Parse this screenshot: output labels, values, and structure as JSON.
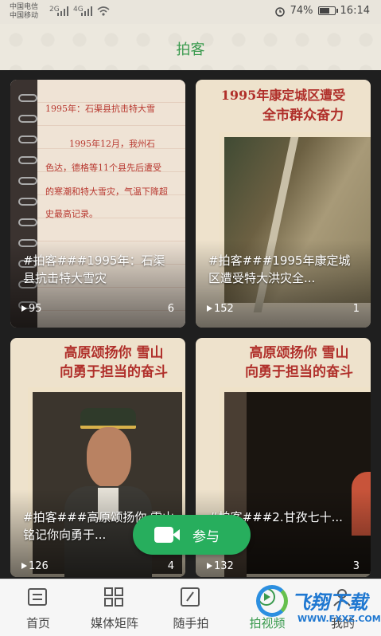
{
  "status_bar": {
    "carrier_1": "中国电信",
    "carrier_2": "中国移动",
    "net_1": "2G",
    "net_2": "4G",
    "battery": "74%",
    "battery_level": 0.74,
    "time": "16:14"
  },
  "header": {
    "title": "拍客"
  },
  "cards": [
    {
      "title": "#拍客###1995年：石渠县抗击特大雪灾",
      "plays": "95",
      "likes": "6",
      "thumb_text": [
        "1995年：石渠县抗击特大雪",
        "1995年12月，我州石",
        "色达，德格等11个县先后遭受",
        "的寒潮和特大雪灾，气温下降超",
        "史最高记录。"
      ]
    },
    {
      "title": "#拍客###1995年康定城区遭受特大洪灾全...",
      "plays": "152",
      "likes": "1",
      "thumb_text": [
        "1995年康定城区遭受",
        "全市群众奋力"
      ]
    },
    {
      "title": "#拍客###高原颂扬你 雪山铭记你向勇于...",
      "plays": "126",
      "likes": "4",
      "thumb_text": [
        "高原颂扬你  雪山",
        "向勇于担当的奋斗"
      ]
    },
    {
      "title": "#拍客###2.甘孜七十...",
      "plays": "132",
      "likes": "3",
      "thumb_text": [
        "高原颂扬你  雪山",
        "向勇于担当的奋斗"
      ]
    }
  ],
  "fab": {
    "label": "参与"
  },
  "bottom_nav": [
    {
      "label": "首页",
      "icon": "home-icon"
    },
    {
      "label": "媒体矩阵",
      "icon": "grid-icon"
    },
    {
      "label": "随手拍",
      "icon": "edit-icon"
    },
    {
      "label": "拍视频",
      "icon": "video-icon"
    },
    {
      "label": "我的",
      "icon": "user-icon"
    }
  ],
  "watermark": {
    "main": "飞翔下载",
    "sub": "WWW.FXXZ.COM"
  },
  "colors": {
    "accent": "#3a9a4e",
    "fab": "#27ae5d",
    "banner_red": "#b02f2a"
  }
}
